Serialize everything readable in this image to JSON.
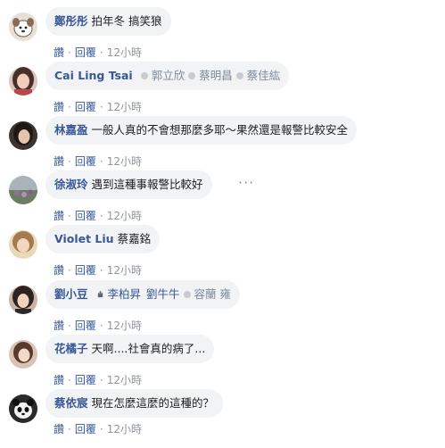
{
  "comments": [
    {
      "author": "鄭彤彤",
      "text": "拍年冬 搞笑狼",
      "actions": {
        "like": "讚",
        "reply": "回覆",
        "time": "12小時"
      }
    },
    {
      "author": "Cai Ling Tsai",
      "text": "",
      "tags": [
        "郭立欣",
        "蔡明昌",
        "蔡佳紘"
      ],
      "actions": {
        "like": "讚",
        "reply": "回覆",
        "time": "12小時"
      }
    },
    {
      "author": "林嘉盈",
      "text": "一般人真的不會想那麼多耶～果然還是報警比較安全",
      "actions": {
        "like": "讚",
        "reply": "回覆",
        "time": "12小時"
      }
    },
    {
      "author": "徐淑玲",
      "text": "遇到這種事報警比較好",
      "more": "···",
      "actions": {
        "like": "讚",
        "reply": "回覆",
        "time": "12小時"
      }
    },
    {
      "author": "Violet Liu",
      "text": "蔡嘉銘",
      "actions": {
        "like": "讚",
        "reply": "回覆",
        "time": "12小時"
      }
    },
    {
      "author": "劉小豆",
      "text": "",
      "tags": [
        "李柏昇",
        "劉牛牛",
        "容蘭 雍"
      ],
      "actions": {
        "like": "讚",
        "reply": "回覆",
        "time": "12小時"
      }
    },
    {
      "author": "花橘子",
      "text": "天啊....社會真的病了...",
      "actions": {
        "like": "讚",
        "reply": "回覆",
        "time": "12小時"
      }
    },
    {
      "author": "蔡依宸",
      "text": "現在怎麼這麼的這種的？",
      "actions": {
        "like": "讚",
        "reply": "回覆",
        "time": "12小時"
      }
    }
  ],
  "colors": {
    "author": "#385898",
    "bubble": "#f2f3f5",
    "meta": "#90949c"
  }
}
